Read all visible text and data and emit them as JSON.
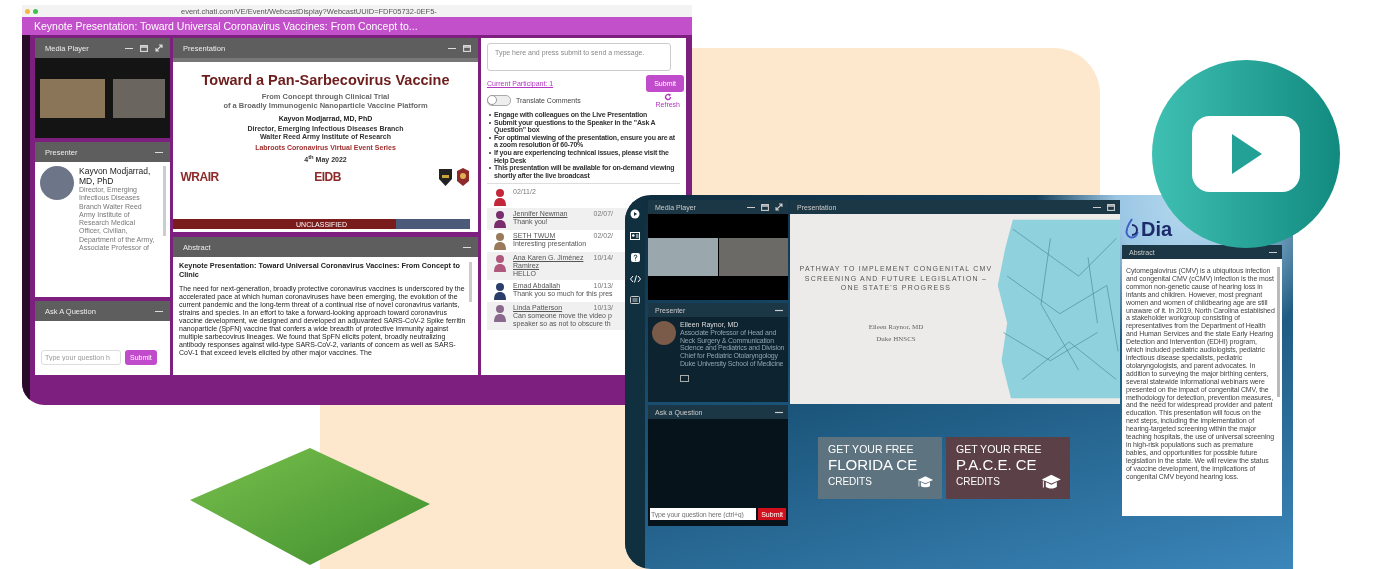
{
  "webcast1": {
    "browser": {
      "url": "event.chati.com/VE/Event/WebcastDisplay?WebcastUUID=FDF05732-0EF5-"
    },
    "title": "Keynote Presentation: Toward Universal Coronavirus Vaccines: From Concept to...",
    "media_player": {
      "title": "Media Player"
    },
    "presenter": {
      "title": "Presenter",
      "name": "Kayvon Modjarrad, MD, PhD",
      "bio": "Director, Emerging Infectious Diseases Branch Walter Reed Army Institute of Research Medical Officer, Civilian, Department of the Army, Associate Professor of"
    },
    "ask": {
      "title": "Ask A Question",
      "placeholder": "Type your question h",
      "button": "Submit"
    },
    "presentation": {
      "title": "Presentation",
      "slide": {
        "title": "Toward a Pan-Sarbecovirus Vaccine",
        "subtitle": [
          "From Concept through Clinical Trial",
          "of a Broadly Immunogenic Nanoparticle Vaccine Platform"
        ],
        "author": "Kayvon Modjarrad, MD, PhD",
        "affiliation": [
          "Director, Emerging Infectious Diseases Branch",
          "Walter Reed Army Institute of Research"
        ],
        "series": "Labroots Coronavirus Virtual Event Series",
        "date": "4$^{th}$ May 2022",
        "logos": [
          "WRAIR",
          "EIDB"
        ],
        "banner": "UNCLASSIFIED"
      }
    },
    "abstract": {
      "title": "Abstract",
      "heading": "Keynote Presentation: Toward Universal Coronavirus Vaccines: From Concept to Clinic",
      "text": "The need for next-generation, broadly protective coronavirus vaccines is underscored by the accelerated pace at which human coronaviruses have been emerging, the evolution of the current pandemic and the long-term threat of a continual rise of novel coronavirus variants, strains and species. In an effort to take a forward-looking approach toward coronavirus vaccine development, we designed and developed an adjuvanted SARS-CoV-2 Spike ferritin nanoparticle (SpFN) vaccine that confers a wide breadth of protective immunity against multiple sarbecovirus lineages. We found that SpFN elicits potent, broadly neutralizing antibody responses against wild-type SARS-CoV-2, variants of concern as well as SARS-CoV-1 that exceed levels elicited by other major vaccines. The"
    },
    "chat": {
      "placeholder": "Type here and press submit to send a message.",
      "participants": "Current Participant: 1",
      "button": "Submit",
      "translate": {
        "label": "Translate Comments",
        "on": false
      },
      "refresh": "Refresh",
      "notes": [
        "Engage with colleagues on the Live Presentation",
        "Submit your questions to the Speaker in the \"Ask A Question\" box",
        "For optimal viewing of the presentation, ensure you are at a zoom resolution of 60-70%",
        "If you are experiencing technical issues, please visit the Help Desk",
        "This presentation will be available for on-demand viewing shortly after the live broadcast"
      ],
      "messages": [
        {
          "date": "02/11/2"
        },
        {
          "name": "Jennifer Newman",
          "date": "02/07/",
          "text": "Thank you!"
        },
        {
          "name": "SETH TWUM",
          "date": "02/02/",
          "text": "Interesting presentation"
        },
        {
          "name": "Ana Karen G. Jiménez Ramirez",
          "date": "10/14/",
          "text": "HELLO"
        },
        {
          "name": "Emad Abdallah",
          "date": "10/13/",
          "text": "Thank you so much for this pres"
        },
        {
          "name": "Linda Patterson",
          "date": "10/13/",
          "text": "Can someone move the video p speaker so as not to obscure th"
        }
      ]
    }
  },
  "webcast2": {
    "media_player": {
      "title": "Media Player"
    },
    "presenter": {
      "title": "Presenter",
      "name": "Eileen Raynor, MD",
      "bio": "Associate Professor of Head and Neck Surgery & Communication Science and Pediatrics and Division Chief for Pediatric Otolaryngology Duke University School of Medicine"
    },
    "ask": {
      "title": "Ask a Question",
      "placeholder": "Type your question here (ctrl+q)",
      "button": "Submit"
    },
    "presentation": {
      "title": "Presentation",
      "slide": {
        "title": "PATHWAY TO IMPLEMENT CONGENITAL CMV SCREENING AND FUTURE LEGISLATION – ONE STATE'S PROGRESS",
        "author": "Eileen Raynor, MD",
        "org": "Duke HNSCS"
      }
    },
    "logo": {
      "text": "Dia"
    },
    "abstract": {
      "title": "Abstract",
      "text": "Cytomegalovirus (CMV) is a ubiquitous infection and congenital CMV (cCMV) infection is the most common non-genetic cause of hearing loss in infants and children. However, most pregnant women and women of childbearing age are still unaware of it. In 2019, North Carolina established a stakeholder workgroup consisting of representatives from the Department of Health and Human Services and the state Early Hearing Detection and Intervention (EDHI) program, which included pediatric audiologists, pediatric infectious disease specialists, pediatric otolaryngologists, and parent advocates. In addition to surveying the major birthing centers, several statewide informational webinars were presented on the impact of congenital CMV, the methodology for detection, prevention measures, and the need for widespread provider and patent education. This presentation will focus on the next steps, including the implementation of hearing-targeted screening within the major teaching hospitals, the use of universal screening in high-risk populations such as premature babies, and opportunities for possible future legislation in the state. We will review the status of vaccine development, the implications of congenital CMV beyond hearing loss."
    },
    "credits": [
      {
        "lines": [
          "GET YOUR FREE",
          "FLORIDA CE",
          "CREDITS"
        ],
        "color": "#5d7480"
      },
      {
        "lines": [
          "GET YOUR FREE",
          "P.A.C.E. CE",
          "CREDITS"
        ],
        "color": "#5b4048"
      }
    ]
  }
}
